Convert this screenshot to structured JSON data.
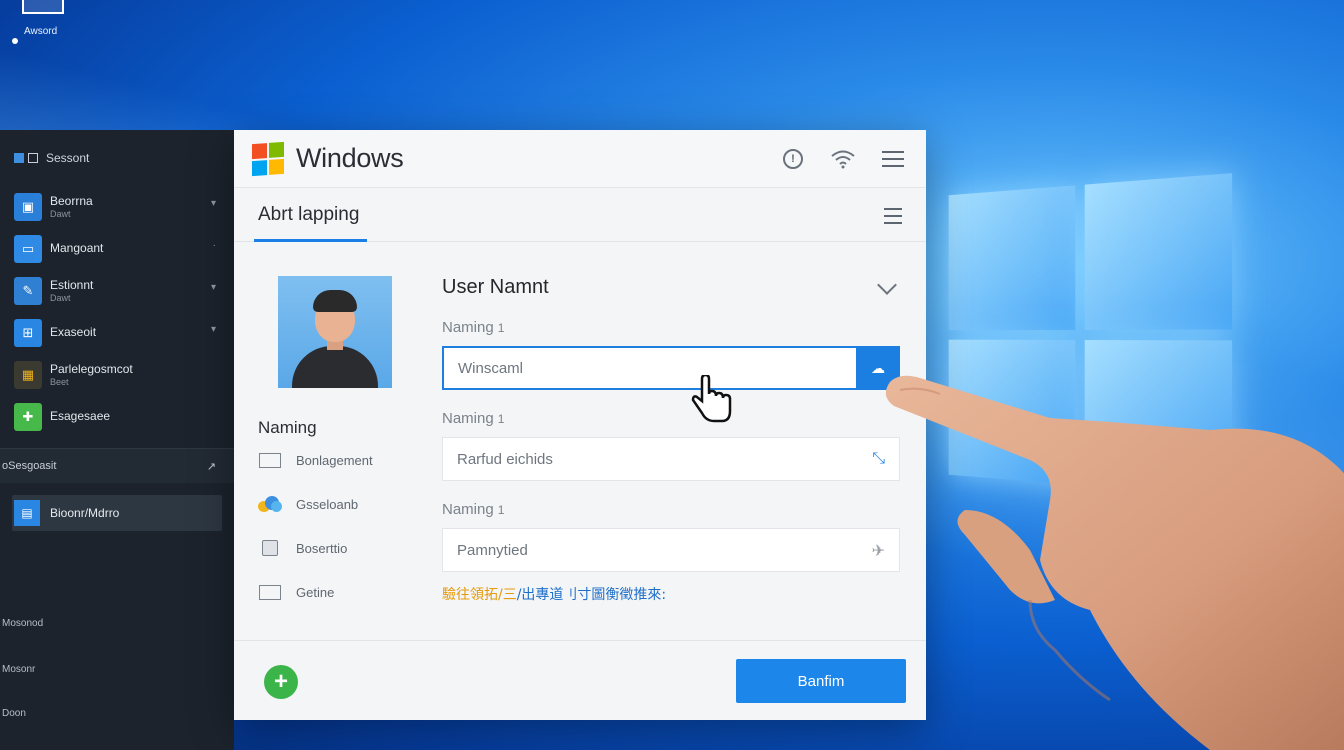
{
  "desktop": {
    "icon_label": "Awsord",
    "colors": {
      "accent": "#1a7fe0",
      "sidebar_bg": "#1c232c",
      "add_green": "#3bb44a"
    }
  },
  "sidebar": {
    "header": "Sessont",
    "items": [
      {
        "label": "Beorrna",
        "sub": "Dawt",
        "icon": "user-icon",
        "color": "#2a7fd8"
      },
      {
        "label": "Mangoant",
        "sub": "",
        "icon": "monitor-icon",
        "color": "#2f8ae6"
      },
      {
        "label": "Estionnt",
        "sub": "Dawt",
        "icon": "edit-icon",
        "color": "#2f7fd2"
      },
      {
        "label": "Exaseoit",
        "sub": "",
        "icon": "windows-icon",
        "color": "#2a86e3"
      },
      {
        "label": "Parlelegosmcot",
        "sub": "Beet",
        "icon": "grid-icon",
        "color": "#d9a21a"
      },
      {
        "label": "Esagesaee",
        "sub": "",
        "icon": "puzzle-icon",
        "color": "#47b84a"
      }
    ],
    "section_row": "oSesgoasit",
    "active_item": "Bioonr/Mdrro",
    "bottom_links": [
      "Mosonod",
      "Mosonr",
      "Doon"
    ]
  },
  "window": {
    "app_title": "Windows",
    "tab_label": "Abrt lapping",
    "avatar_section_title": "Naming",
    "side_links": [
      {
        "label": "Bonlagement",
        "icon": "window-icon"
      },
      {
        "label": "Gsseloanb",
        "icon": "cloud-icon"
      },
      {
        "label": "Boserttio",
        "icon": "printer-icon"
      },
      {
        "label": "Getine",
        "icon": "document-icon"
      }
    ],
    "form": {
      "title": "User Namnt",
      "fields": [
        {
          "label": "Naming",
          "sup": "1",
          "value": "Winscaml",
          "icon": "cloud-upload-icon"
        },
        {
          "label": "Naming",
          "sup": "1",
          "value": "Rarfud eichids",
          "icon": "expand-icon"
        },
        {
          "label": "Naming",
          "sup": "1",
          "value": "Pamnytied",
          "icon": "airplane-icon"
        }
      ],
      "note_orange": "驗往領拓/",
      "note_separator": "三",
      "note_blue": "/出專道刂寸圖衡徵推來:"
    },
    "primary_button": "Banfim",
    "add_button": "+"
  }
}
